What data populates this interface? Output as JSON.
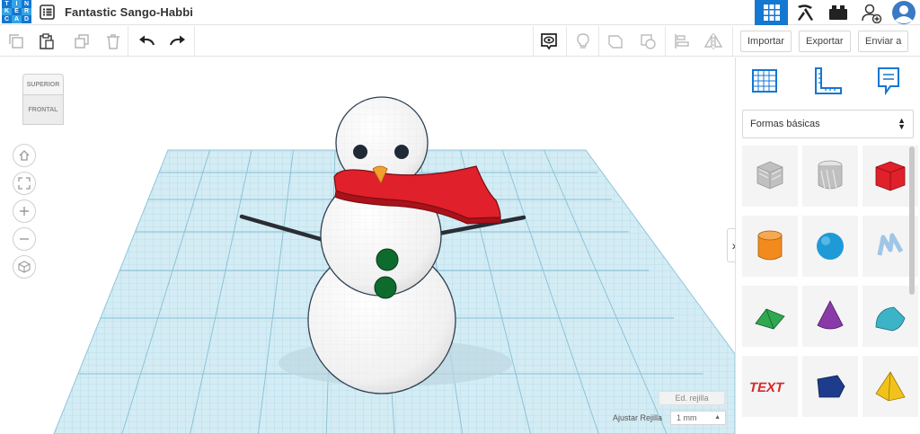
{
  "app": {
    "logo_letters": [
      "T",
      "I",
      "N",
      "K",
      "E",
      "R",
      "C",
      "A",
      "D"
    ],
    "design_title": "Fantastic Sango-Habbi",
    "brand_color": "#1477d1"
  },
  "top_nav": {
    "buttons": [
      {
        "name": "3d-design-view",
        "icon": "grid-icon",
        "active": true
      },
      {
        "name": "codeblocks-view",
        "icon": "pickaxe-icon",
        "active": false
      },
      {
        "name": "bricks-view",
        "icon": "brick-icon",
        "active": false
      },
      {
        "name": "invite-user",
        "icon": "add-user-icon",
        "active": false
      }
    ]
  },
  "toolbar": {
    "import_label": "Importar",
    "export_label": "Exportar",
    "send_label": "Enviar a"
  },
  "viewcube": {
    "top_label": "SUPERIOR",
    "front_label": "FRONTAL"
  },
  "workplane": {
    "grid_color": "#b9dfec",
    "edit_grid_label": "Ed. rejilla",
    "snap_label": "Ajustar Rejilla",
    "snap_value": "1 mm"
  },
  "library": {
    "category_label": "Formas básicas",
    "shapes": [
      {
        "name": "box-hole",
        "color": "#c0c0c0"
      },
      {
        "name": "cylinder-hole",
        "color": "#c0c0c0"
      },
      {
        "name": "box",
        "color": "#e0202a"
      },
      {
        "name": "cylinder",
        "color": "#f28a1e"
      },
      {
        "name": "sphere",
        "color": "#1e9ad6"
      },
      {
        "name": "scribble",
        "color": "#9fc6e6"
      },
      {
        "name": "roof",
        "color": "#2fa84f"
      },
      {
        "name": "cone",
        "color": "#8a3aa8"
      },
      {
        "name": "round-roof",
        "color": "#3db3c8"
      },
      {
        "name": "text",
        "color": "#d42a2a"
      },
      {
        "name": "polygon",
        "color": "#1e3c8c"
      },
      {
        "name": "pyramid",
        "color": "#f2c21a"
      }
    ]
  },
  "scene": {
    "snowman_body_color": "#ffffff",
    "scarf_color": "#e0202a",
    "button_color": "#0e6b2e",
    "nose_color": "#f2a02e",
    "arm_color": "#2a2d33"
  }
}
